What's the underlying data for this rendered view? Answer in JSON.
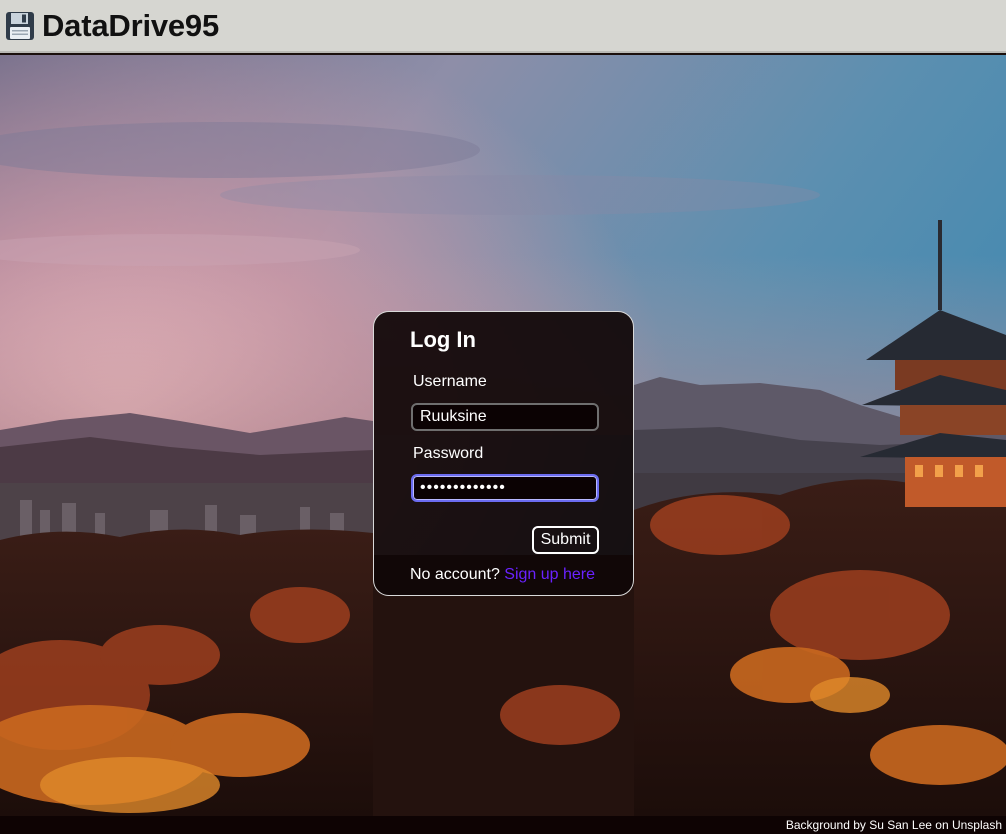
{
  "header": {
    "app_title": "DataDrive95",
    "icon": "floppy-disk-icon"
  },
  "login": {
    "title": "Log In",
    "username_label": "Username",
    "username_value": "Ruuksine",
    "password_label": "Password",
    "password_value": "•••••••••••••",
    "submit_label": "Submit",
    "no_account_text": "No account? ",
    "signup_link": "Sign up here"
  },
  "footer": {
    "credit": "Background by Su San Lee on Unsplash"
  },
  "colors": {
    "header_bg": "#d6d6d1",
    "card_bg": "#100606",
    "link": "#6a22ff",
    "focus_border": "#6b6cf0"
  }
}
